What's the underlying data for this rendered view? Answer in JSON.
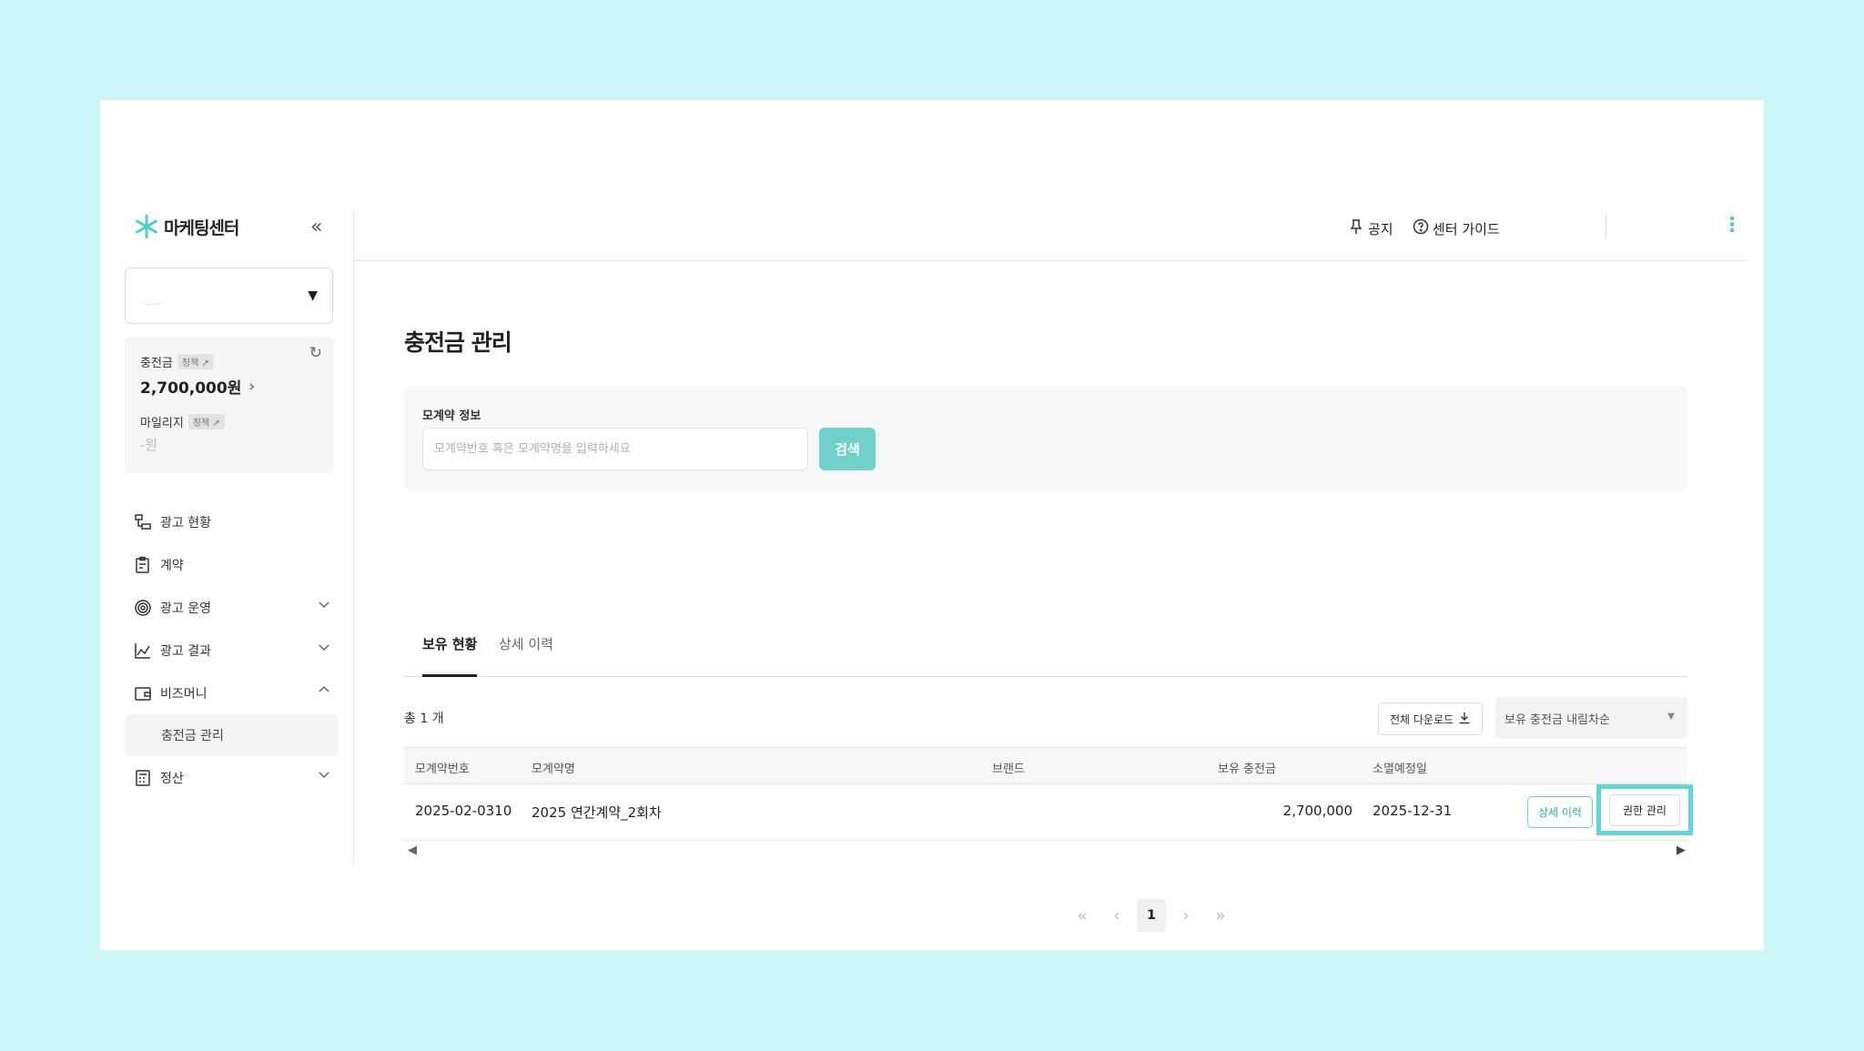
{
  "app": {
    "title": "마케팅센터"
  },
  "balance": {
    "charge_label": "충전금",
    "charge_tag": "정책 ↗",
    "charge_value": "2,700,000원",
    "mileage_label": "마일리지",
    "mileage_tag": "정책 ↗",
    "mileage_value": "-원"
  },
  "sidebar": {
    "items": [
      {
        "label": "광고 현황",
        "icon": "ad-status-icon"
      },
      {
        "label": "계약",
        "icon": "contract-icon"
      },
      {
        "label": "광고 운영",
        "icon": "ad-operation-icon"
      },
      {
        "label": "광고 결과",
        "icon": "ad-result-icon"
      },
      {
        "label": "비즈머니",
        "icon": "wallet-icon"
      },
      {
        "label": "정산",
        "icon": "settlement-icon"
      }
    ],
    "sub_item": "충전금 관리"
  },
  "topbar": {
    "notice": "공지",
    "guide": "센터 가이드",
    "more": "⋮"
  },
  "page": {
    "title": "충전금 관리"
  },
  "search": {
    "label": "모계약 정보",
    "placeholder": "모계약번호 혹은 모계약명을 입력하세요",
    "button": "검색"
  },
  "tabs": {
    "holding": "보유 현황",
    "history": "상세 이력"
  },
  "toolbar": {
    "total": "총 1 개",
    "download": "전체 다운로드",
    "sort": "보유 충전금 내림차순"
  },
  "table": {
    "headers": [
      "모계약번호",
      "모계약명",
      "브랜드",
      "보유 충전금",
      "소멸예정일"
    ],
    "rows": [
      {
        "contract_no": "2025-02-0310",
        "contract_name": "2025 연간계약_2회차",
        "brand": "",
        "balance": "2,700,000",
        "expiry": "2025-12-31"
      }
    ],
    "detail_button": "상세 이력",
    "permission_button": "권한 관리"
  },
  "pagination": {
    "first": "«",
    "prev": "‹",
    "current": "1",
    "next": "›",
    "last": "»"
  },
  "colors": {
    "accent": "#6fd1ca",
    "highlight": "#5fd6d8",
    "background": "#cdf7f6"
  }
}
